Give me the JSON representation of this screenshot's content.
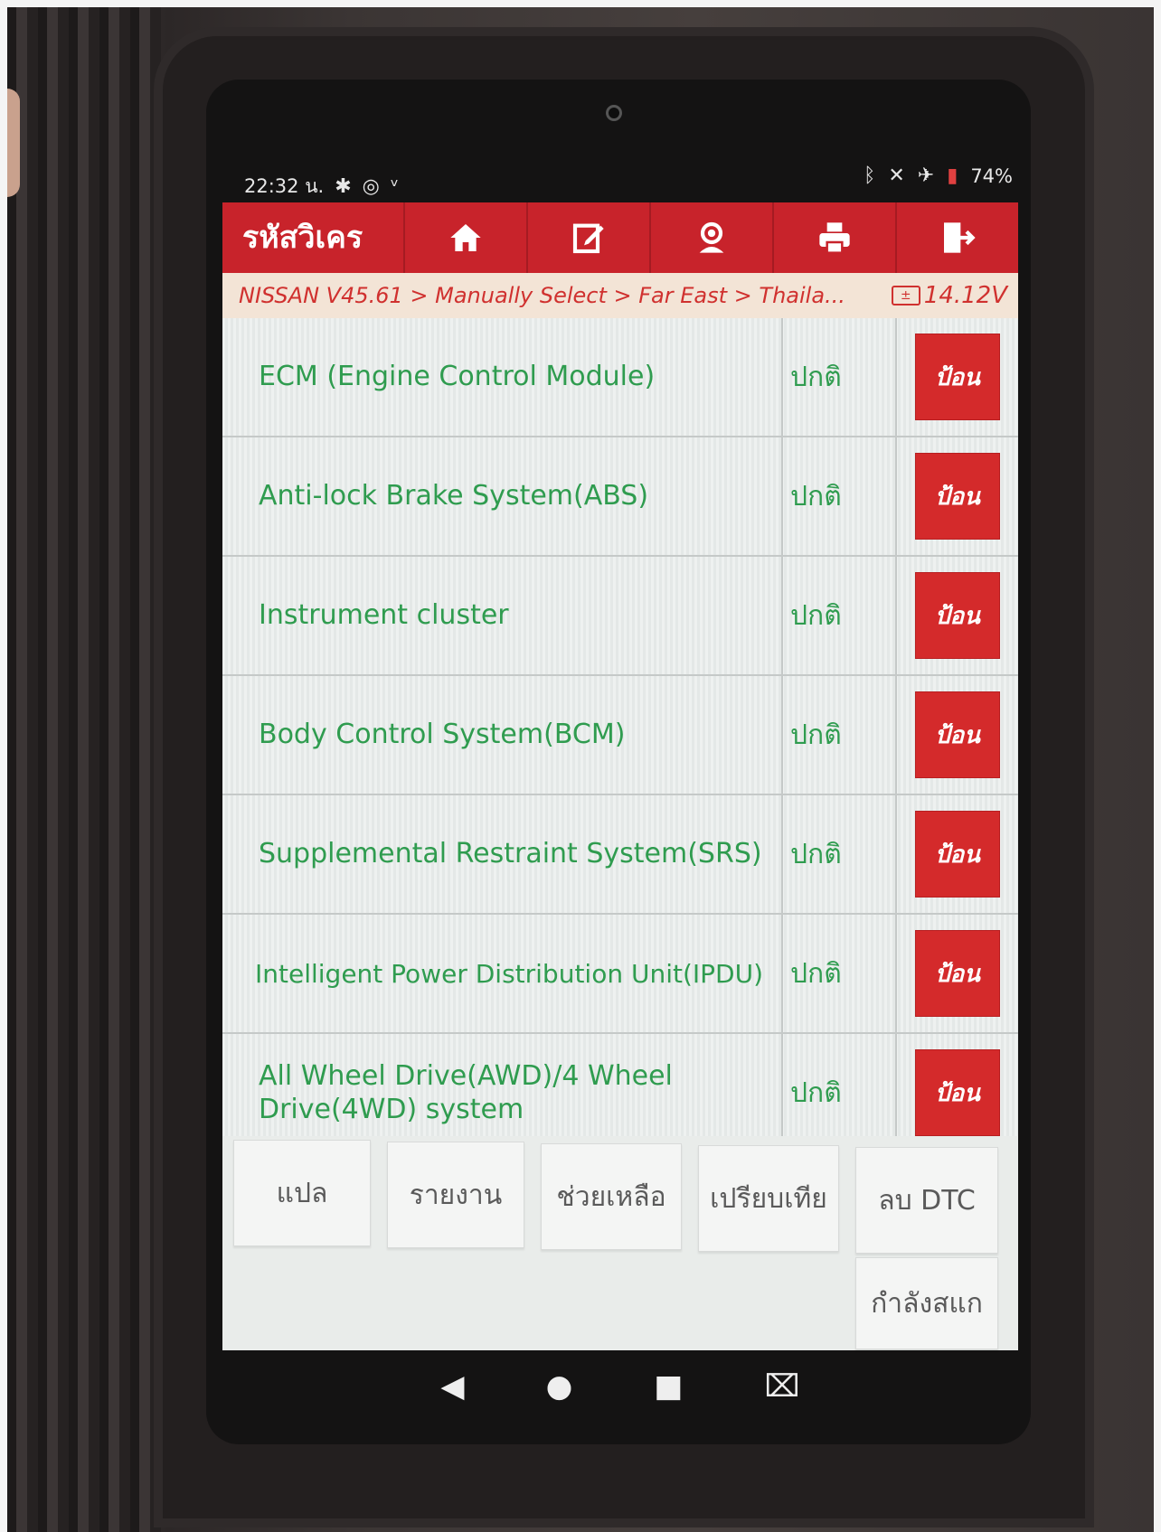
{
  "status_bar": {
    "time": "22:32 น.",
    "battery": "74%"
  },
  "toolbar": {
    "title": "รหัสวิเคร",
    "buttons": [
      "home-icon",
      "edit-icon",
      "support-icon",
      "print-icon",
      "exit-icon"
    ]
  },
  "breadcrumb": {
    "path": "NISSAN V45.61 > Manually Select > Far East > Thaila...",
    "voltage": "14.12V"
  },
  "systems": [
    {
      "name": "ECM (Engine Control Module)",
      "status": "ปกติ",
      "action": "ป้อน"
    },
    {
      "name": "Anti-lock Brake System(ABS)",
      "status": "ปกติ",
      "action": "ป้อน"
    },
    {
      "name": "Instrument cluster",
      "status": "ปกติ",
      "action": "ป้อน"
    },
    {
      "name": "Body Control System(BCM)",
      "status": "ปกติ",
      "action": "ป้อน"
    },
    {
      "name": "Supplemental Restraint System(SRS)",
      "status": "ปกติ",
      "action": "ป้อน"
    },
    {
      "name": "Intelligent Power Distribution Unit(IPDU)",
      "status": "ปกติ",
      "action": "ป้อน"
    },
    {
      "name": "All Wheel Drive(AWD)/4 Wheel Drive(4WD) system",
      "status": "ปกติ",
      "action": "ป้อน"
    }
  ],
  "footer": {
    "translate": "แปล",
    "report": "รายงาน",
    "help": "ช่วยเหลือ",
    "compare": "เปรียบเทีย",
    "clear_dtc": "ลบ DTC",
    "scanning": "กำลังสแก"
  },
  "colors": {
    "toolbar": "#c8232b",
    "system_text": "#2f9c4f",
    "enter_button": "#d42a2b"
  }
}
